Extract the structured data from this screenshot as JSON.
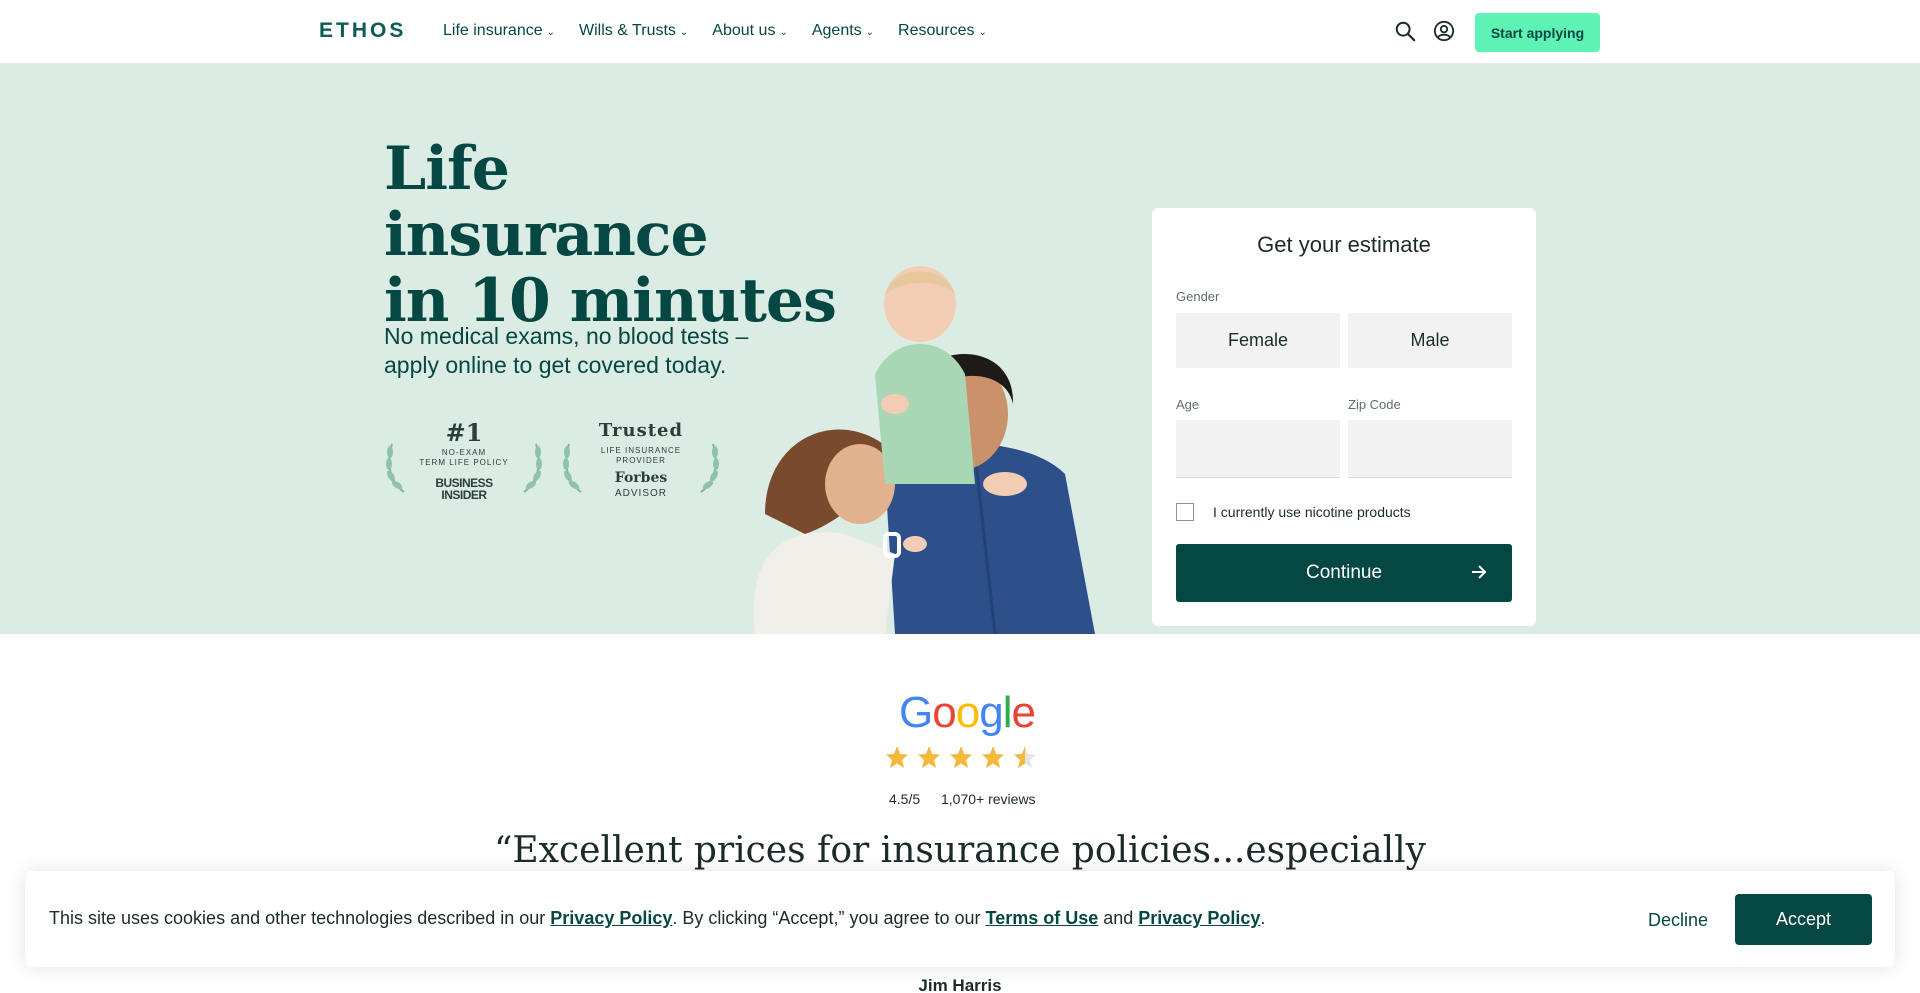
{
  "nav": {
    "logo": "ETHOS",
    "menu": [
      {
        "label": "Life insurance"
      },
      {
        "label": "Wills & Trusts"
      },
      {
        "label": "About us"
      },
      {
        "label": "Agents"
      },
      {
        "label": "Resources"
      }
    ],
    "start_button": "Start applying"
  },
  "hero": {
    "title_line1": "Life insurance",
    "title_line2": "in 10 minutes",
    "subtitle_line1": "No medical exams, no blood tests –",
    "subtitle_line2": "apply online to get covered today.",
    "badges": [
      {
        "top": "#1",
        "line1": "NO-EXAM",
        "line2": "TERM LIFE POLICY",
        "brand1": "BUSINESS",
        "brand2": "INSIDER"
      },
      {
        "top": "Trusted",
        "line1": "LIFE INSURANCE",
        "line2": "PROVIDER",
        "brand1": "Forbes",
        "brand2": "ADVISOR"
      }
    ]
  },
  "form": {
    "title": "Get your estimate",
    "gender_label": "Gender",
    "gender_options": [
      "Female",
      "Male"
    ],
    "age_label": "Age",
    "age_value": "",
    "zip_label": "Zip Code",
    "zip_value": "",
    "nicotine_label": "I currently use nicotine products",
    "nicotine_checked": false,
    "continue_label": "Continue"
  },
  "reviews": {
    "brand": "Google",
    "stars": 4.5,
    "rating": "4.5/5",
    "count": "1,070+ reviews",
    "quote": "“Excellent prices for insurance policies...especially",
    "reviewer": "Jim Harris"
  },
  "cookie": {
    "text1": "This site uses cookies and other technologies described in our ",
    "link1": "Privacy Policy",
    "text2": ". By clicking “Accept,” you agree to our ",
    "link2": "Terms of Use",
    "text3": " and ",
    "link3": "Privacy Policy",
    "text4": ".",
    "decline": "Decline",
    "accept": "Accept"
  },
  "colors": {
    "brand_dark": "#054742",
    "accent_mint": "#5ef2b5",
    "hero_bg": "#daece4",
    "star": "#f6b73c"
  }
}
